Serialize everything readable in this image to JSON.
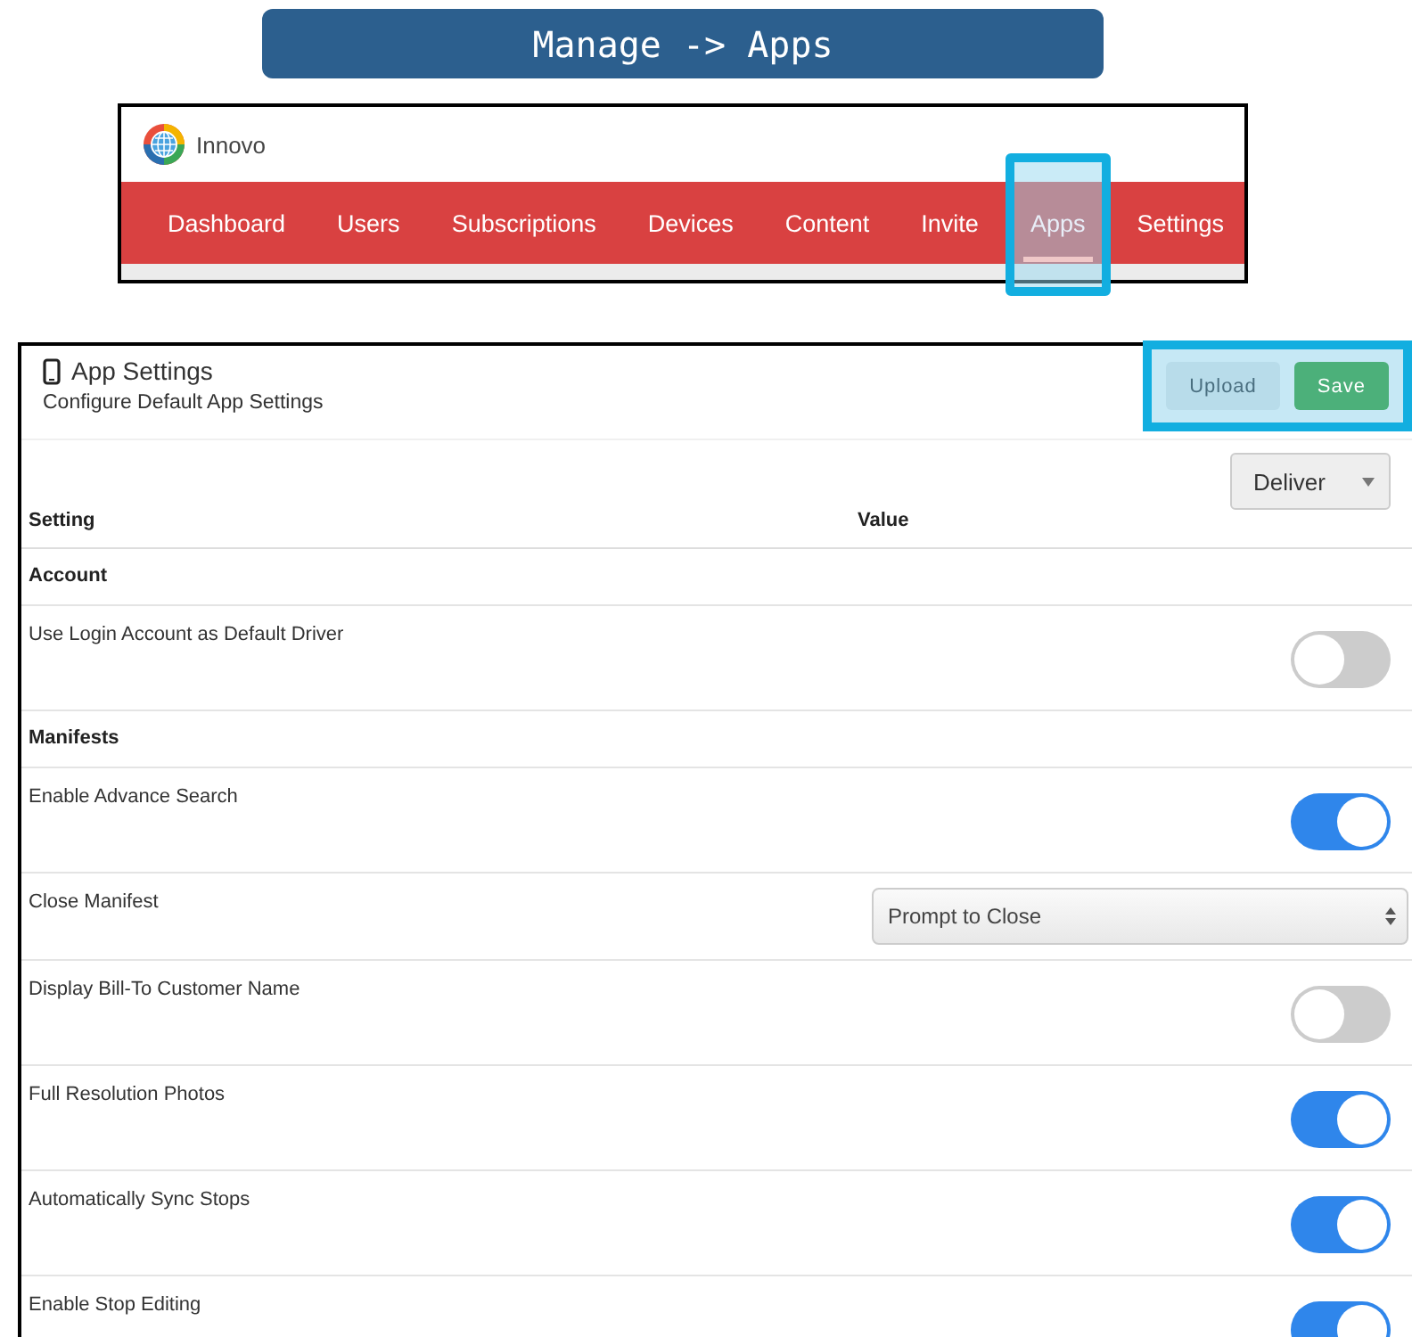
{
  "banner": {
    "title": "Manage -> Apps"
  },
  "nav_preview": {
    "brand": "Innovo",
    "tabs": [
      {
        "label": "Dashboard",
        "selected": false
      },
      {
        "label": "Users",
        "selected": false
      },
      {
        "label": "Subscriptions",
        "selected": false
      },
      {
        "label": "Devices",
        "selected": false
      },
      {
        "label": "Content",
        "selected": false
      },
      {
        "label": "Invite",
        "selected": false
      },
      {
        "label": "Apps",
        "selected": true
      },
      {
        "label": "Settings",
        "selected": false
      }
    ]
  },
  "panel": {
    "title": "App Settings",
    "subtitle": "Configure Default App Settings",
    "actions": {
      "highlighted": true,
      "buttons": [
        {
          "label": "Upload",
          "kind": "secondary"
        },
        {
          "label": "Save",
          "kind": "primary"
        }
      ]
    },
    "mode_select": {
      "value": "Deliver"
    },
    "columns": [
      "Setting",
      "Value"
    ],
    "rows": [
      {
        "kind": "section",
        "label": "Account"
      },
      {
        "kind": "toggle",
        "label": "Use Login Account as Default Driver",
        "on": false
      },
      {
        "kind": "section",
        "label": "Manifests"
      },
      {
        "kind": "toggle",
        "label": "Enable Advance Search",
        "on": true
      },
      {
        "kind": "select",
        "label": "Close Manifest",
        "value": "Prompt to Close"
      },
      {
        "kind": "toggle",
        "label": "Display Bill-To Customer Name",
        "on": false
      },
      {
        "kind": "toggle",
        "label": "Full Resolution Photos",
        "on": true
      },
      {
        "kind": "toggle",
        "label": "Automatically Sync Stops",
        "on": true
      },
      {
        "kind": "toggle",
        "label": "Enable Stop Editing",
        "on": true
      }
    ]
  }
}
